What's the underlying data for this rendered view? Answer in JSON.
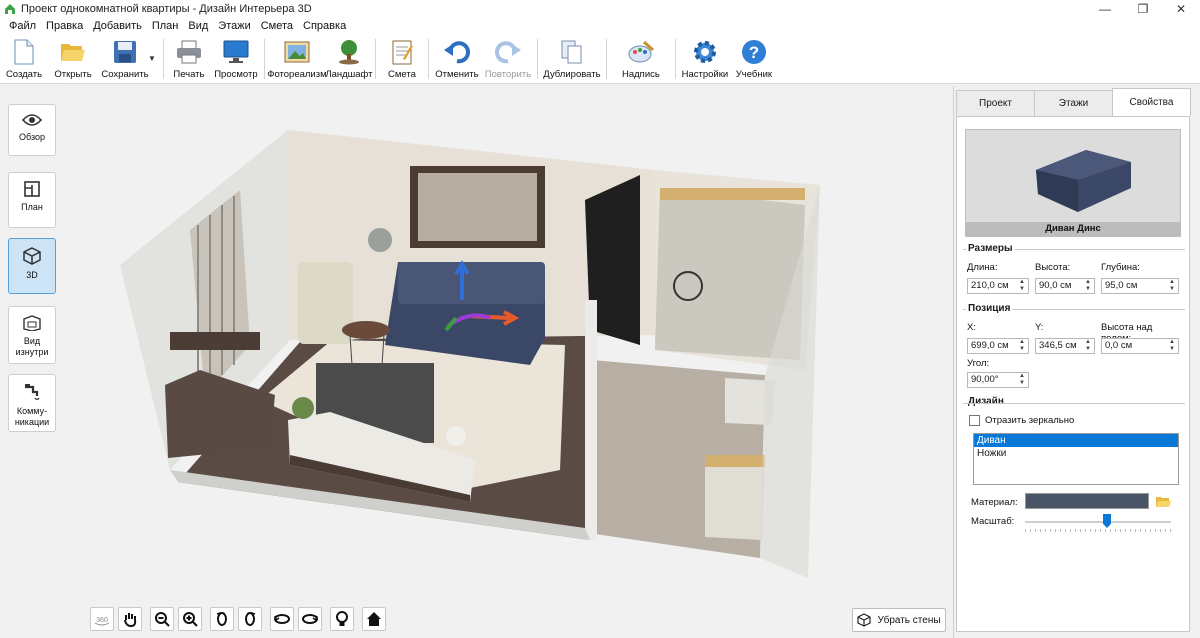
{
  "window": {
    "title": "Проект однокомнатной квартиры - Дизайн Интерьера 3D",
    "minimize": "—",
    "maximize": "❐",
    "close": "✕"
  },
  "menu": [
    "Файл",
    "Правка",
    "Добавить",
    "План",
    "Вид",
    "Этажи",
    "Смета",
    "Справка"
  ],
  "toolbar": {
    "create": "Создать",
    "open": "Открыть",
    "save": "Сохранить",
    "print": "Печать",
    "preview": "Просмотр",
    "photorealism": "Фотореализм",
    "landscape": "Ландшафт",
    "estimate": "Смета",
    "undo": "Отменить",
    "redo": "Повторить",
    "duplicate": "Дублировать",
    "caption": "Надпись",
    "settings": "Настройки",
    "tutorial": "Учебник"
  },
  "sidebar": {
    "overview": "Обзор",
    "plan": "План",
    "view3d": "3D",
    "inside": "Вид изнутри",
    "utilities": "Комму-никации"
  },
  "viewport": {
    "remove_walls": "Убрать стены"
  },
  "panel": {
    "tabs": [
      "Проект",
      "Этажи",
      "Свойства"
    ],
    "active_tab": "Свойства",
    "object_name": "Диван Динс",
    "sizes": {
      "title": "Размеры",
      "length_label": "Длина:",
      "length": "210,0 см",
      "height_label": "Высота:",
      "height": "90,0 см",
      "depth_label": "Глубина:",
      "depth": "95,0 см"
    },
    "position": {
      "title": "Позиция",
      "x_label": "X:",
      "x": "699,0 см",
      "y_label": "Y:",
      "y": "346,5 см",
      "elev_label": "Высота над полом:",
      "elev": "0,0 см",
      "angle_label": "Угол:",
      "angle": "90,00°"
    },
    "design": {
      "title": "Дизайн",
      "mirror_label": "Отразить зеркально",
      "parts": [
        "Диван",
        "Ножки"
      ],
      "selected_part": "Диван",
      "material_label": "Материал:",
      "material_color": "#4a5467",
      "scale_label": "Масштаб:"
    }
  },
  "colors": {
    "accent": "#0a78d7",
    "sofa": "#3b4766",
    "floor": "#5b4b45",
    "walls": "#e6e0d6"
  }
}
